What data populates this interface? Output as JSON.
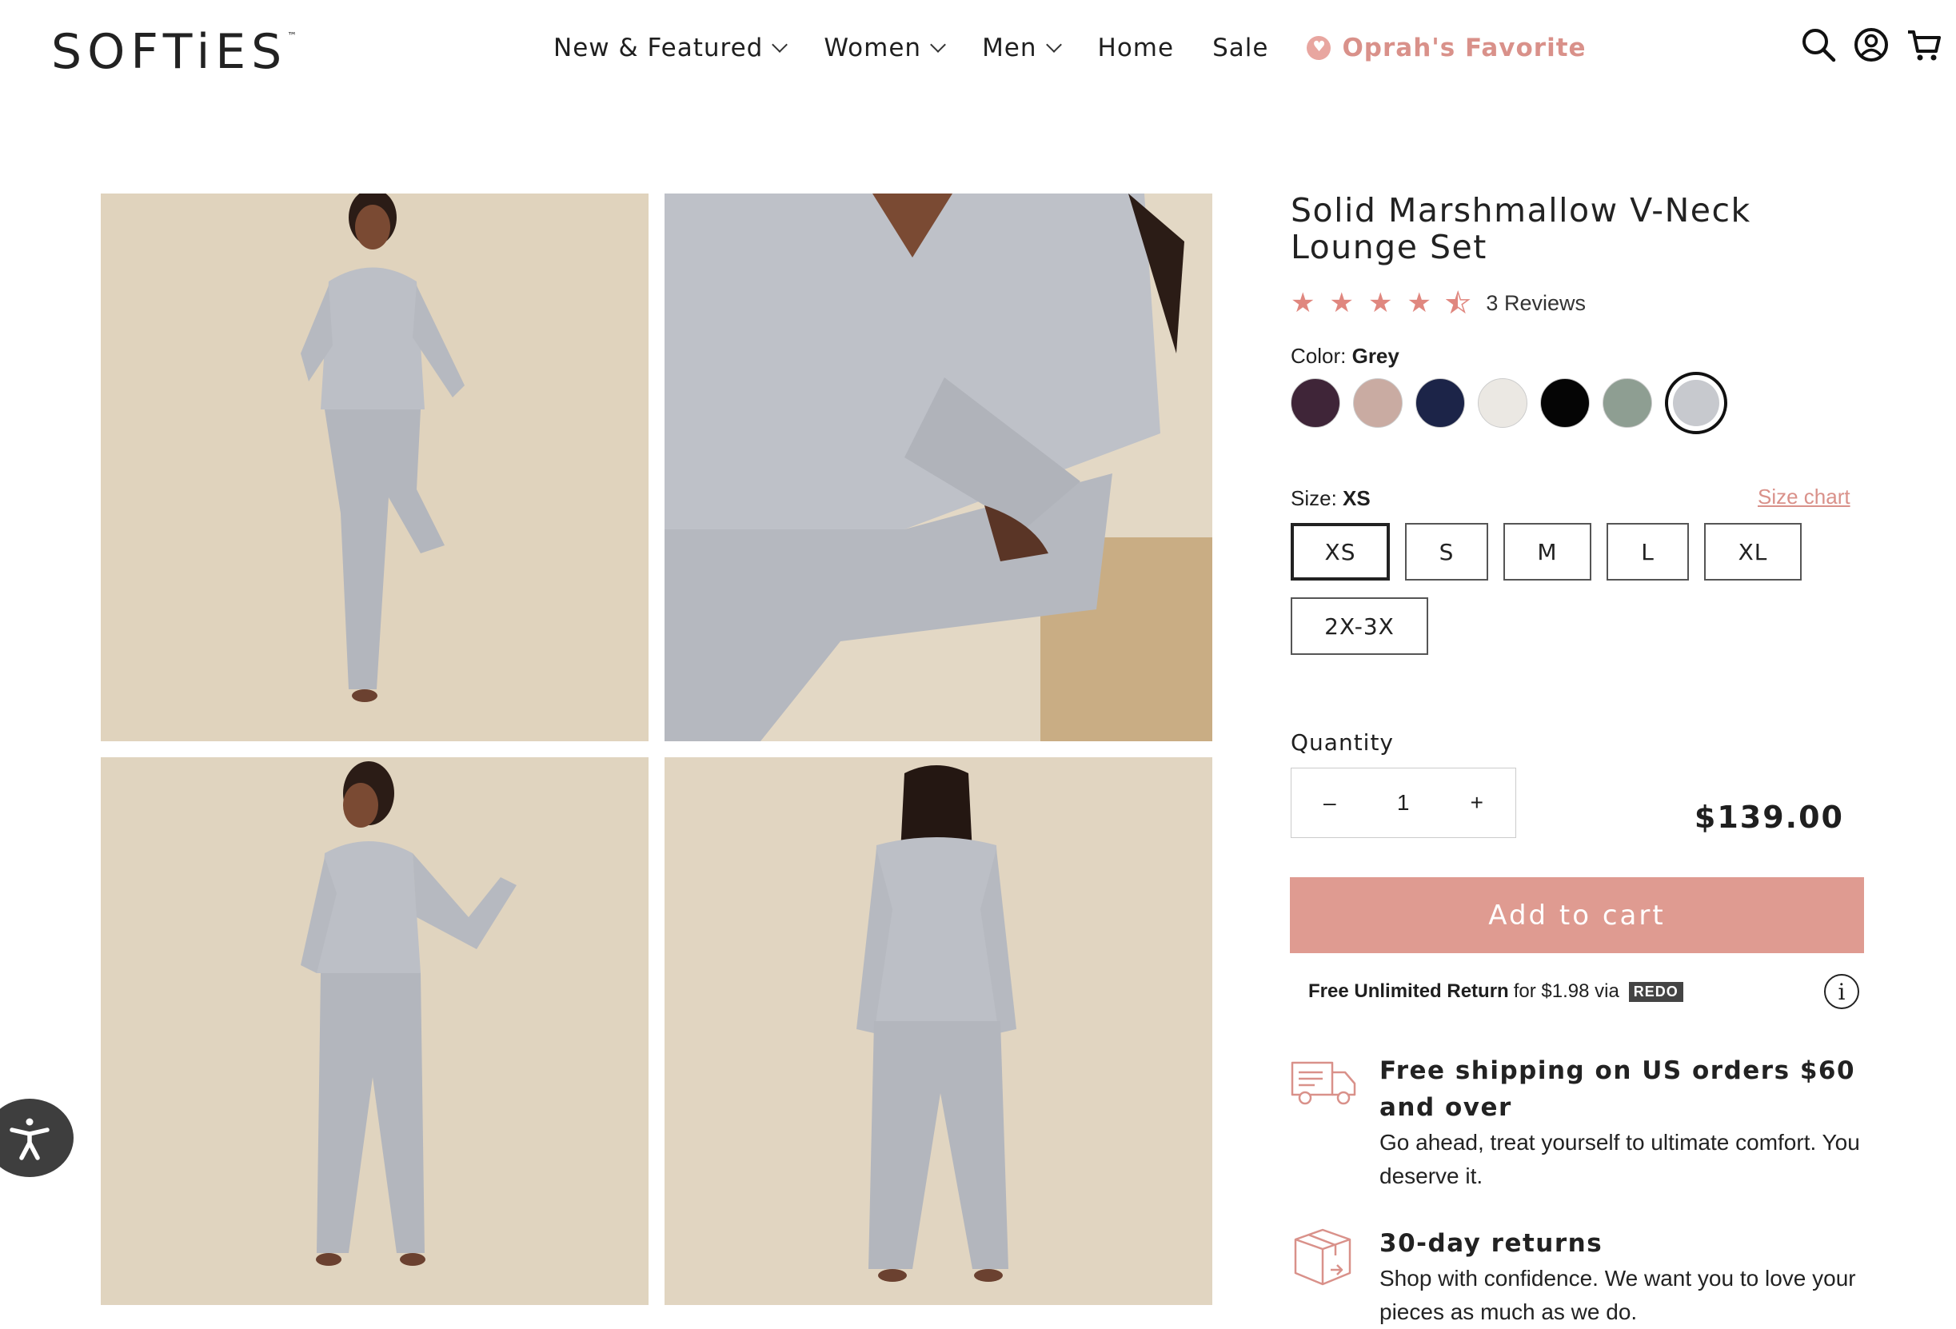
{
  "brand": {
    "logo_text": "SOFTiES",
    "logo_mark": "™"
  },
  "nav": {
    "items": [
      {
        "label": "New & Featured",
        "has_dropdown": true
      },
      {
        "label": "Women",
        "has_dropdown": true
      },
      {
        "label": "Men",
        "has_dropdown": true
      },
      {
        "label": "Home",
        "has_dropdown": false
      },
      {
        "label": "Sale",
        "has_dropdown": false
      }
    ],
    "highlight": {
      "label": "Oprah's Favorite",
      "icon": "heart-badge-icon",
      "color": "#d9918a"
    }
  },
  "header_icons": [
    "search-icon",
    "account-icon",
    "cart-icon"
  ],
  "gallery": {
    "images": [
      {
        "icon": "product-photo-front-pose"
      },
      {
        "icon": "product-photo-seated-closeup"
      },
      {
        "icon": "product-photo-sleeve-detail"
      },
      {
        "icon": "product-photo-back-view"
      }
    ],
    "background_color": "#e2d6c2",
    "garment_color": "#b9bcc3"
  },
  "product": {
    "title": "Solid Marshmallow V-Neck Lounge Set",
    "rating": 4.5,
    "rating_max": 5,
    "reviews_label": "3 Reviews",
    "color_label": "Color:",
    "color_selected": "Grey",
    "swatches": [
      {
        "color": "#3f2538"
      },
      {
        "color": "#c9aba2"
      },
      {
        "color": "#1c2448"
      },
      {
        "color": "#ebe8e3"
      },
      {
        "color": "#050505"
      },
      {
        "color": "#8e9e92"
      },
      {
        "color": "#c7c9ce",
        "selected": true
      }
    ],
    "size_label": "Size:",
    "size_selected": "XS",
    "size_chart_link": "Size chart",
    "sizes": [
      "XS",
      "S",
      "M",
      "L",
      "XL",
      "2X-3X"
    ],
    "quantity_label": "Quantity",
    "quantity_minus": "–",
    "quantity_value": "1",
    "quantity_plus": "+",
    "price": "$139.00",
    "add_to_cart": "Add to cart",
    "accent_color": "#df9b91"
  },
  "returns": {
    "bold": "Free Unlimited Return",
    "text": "for $1.98 via",
    "partner": "REDO",
    "info_icon": "i"
  },
  "features": [
    {
      "icon": "delivery-truck-icon",
      "title": "Free shipping on US orders $60 and over",
      "desc": "Go ahead, treat yourself to ultimate comfort. You deserve it."
    },
    {
      "icon": "box-return-icon",
      "title": "30-day returns",
      "desc": "Shop with confidence. We want you to love your pieces as much as we do."
    }
  ],
  "accessibility": {
    "icon": "accessibility-icon"
  }
}
